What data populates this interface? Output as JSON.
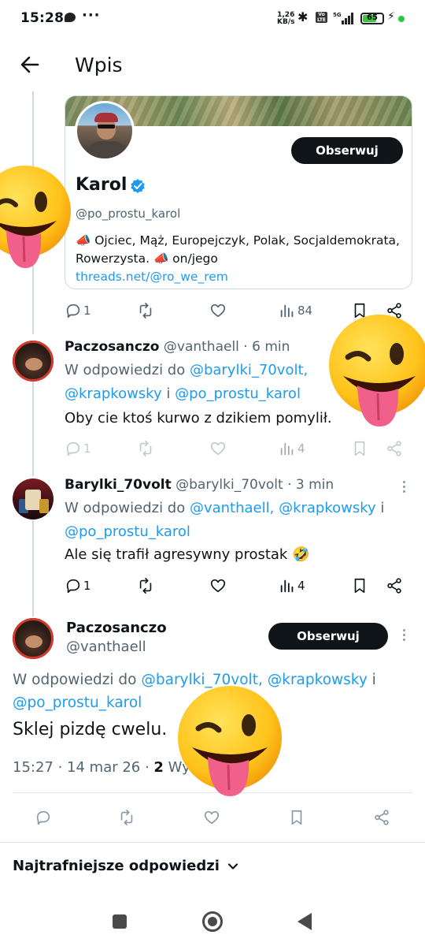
{
  "status_bar": {
    "time": "15:28",
    "speed_value": "1,26",
    "speed_unit": "KB/s",
    "network": "5G",
    "battery": "65",
    "battery_level": 0.65
  },
  "header": {
    "title": "Wpis"
  },
  "profile_card": {
    "name": "Karol",
    "handle": "@po_prostu_karol",
    "bio": "📣 Ojciec, Mąż, Europejczyk, Polak, Socjaldemokrata, Rowerzysta. 📣 on/jego",
    "link": "threads.net/@ro_we_rem",
    "follow_label": "Obserwuj"
  },
  "card_actions": {
    "reply_count": "1",
    "views": "84"
  },
  "replies": [
    {
      "name": "Paczosanczo",
      "meta": "@vanthaell · 6 min",
      "reply_prefix": "W odpowiedzi do ",
      "mention_1": "@barylki_70volt,",
      "mention_2": "@krapkowsky",
      "joiner": " i ",
      "mention_3": "@po_prostu_karol",
      "body": "Oby cie ktoś kurwo z dzikiem pomylił.",
      "reply_count": "1",
      "views": "4"
    },
    {
      "name": "Barylki_70volt",
      "meta": "@barylki_70volt · 3 min",
      "reply_prefix": "W odpowiedzi do ",
      "mention_1": "@vanthaell,",
      "mention_2": "@krapkowsky",
      "joiner": " i",
      "mention_3": "@po_prostu_karol",
      "body": "Ale się trafił agresywny prostak 🤣",
      "reply_count": "1",
      "views": "4"
    }
  ],
  "focused_post": {
    "name": "Paczosanczo",
    "handle": "@vanthaell",
    "follow_label": "Obserwuj",
    "reply_prefix": "W odpowiedzi do ",
    "mention_1": "@barylki_70volt,",
    "mention_2": "@krapkowsky",
    "joiner": " i",
    "mention_3": "@po_prostu_karol",
    "body": "Sklej pizdę cwelu.",
    "timestamp": "15:27 · 14 mar 26 · ",
    "views_number": "2",
    "views_label": " Wyś"
  },
  "sort": {
    "label": "Najtrafniejsze odpowiedzi"
  },
  "colors": {
    "accent": "#1d9bf0",
    "text_primary": "#0f1419",
    "text_secondary": "#536471",
    "button_dark": "#0f1419",
    "battery_green": "#3cc43c"
  },
  "icons": [
    "back-arrow-icon",
    "verified-badge-icon",
    "reply-icon",
    "repost-icon",
    "like-icon",
    "views-icon",
    "bookmark-icon",
    "share-icon",
    "more-icon",
    "chevron-down-icon",
    "winking-tongue-emoji-icon"
  ]
}
